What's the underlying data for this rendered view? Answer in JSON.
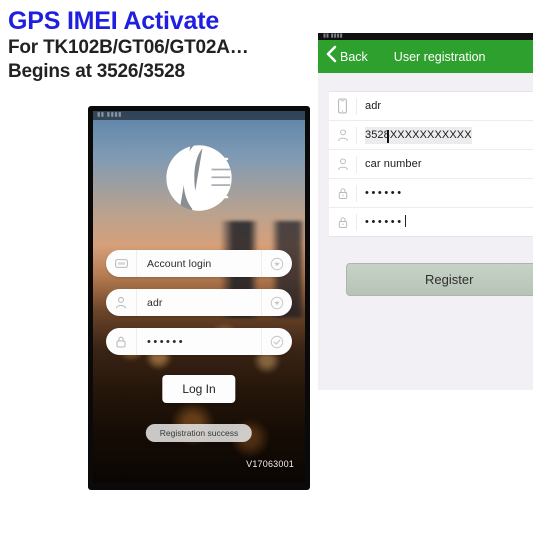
{
  "header": {
    "title": "GPS IMEI Activate",
    "line2": "For TK102B/GT06/GT02A…",
    "line3": "Begins at 3526/3528",
    "title_color": "#1f1fe0",
    "sub_color": "#222222"
  },
  "phone": {
    "status_bar_text": "▮▮ ▮▮▮▮",
    "logo_name": "app-logo",
    "fields": [
      {
        "icon": "card-icon",
        "value": "Account login",
        "type": "text",
        "action": "chevron-down-icon"
      },
      {
        "icon": "person-icon",
        "value": "adr",
        "type": "text",
        "action": "chevron-down-icon"
      },
      {
        "icon": "lock-icon",
        "value": "••••••",
        "type": "password",
        "action": "check-circle-icon"
      }
    ],
    "login_button": "Log In",
    "toast": "Registration success",
    "version": "V17063001"
  },
  "registration": {
    "status_bar_text": "▮▮ ▮▮▮▮",
    "back_label": "Back",
    "title": "User registration",
    "header_color": "#2da02d",
    "rows": [
      {
        "icon": "smartphone-icon",
        "value": "adr",
        "type": "text"
      },
      {
        "icon": "person-icon",
        "value": "3528XXXXXXXXXXX",
        "type": "imei",
        "prefix": "3528",
        "mask": "XXXXXXXXXXX"
      },
      {
        "icon": "person-icon",
        "value": "car number",
        "type": "text"
      },
      {
        "icon": "lock-icon",
        "value": "••••••",
        "type": "password"
      },
      {
        "icon": "lock-icon",
        "value": "••••••",
        "type": "password",
        "focused": true
      }
    ],
    "register_button": "Register",
    "register_button_color": "#bdcabd"
  }
}
